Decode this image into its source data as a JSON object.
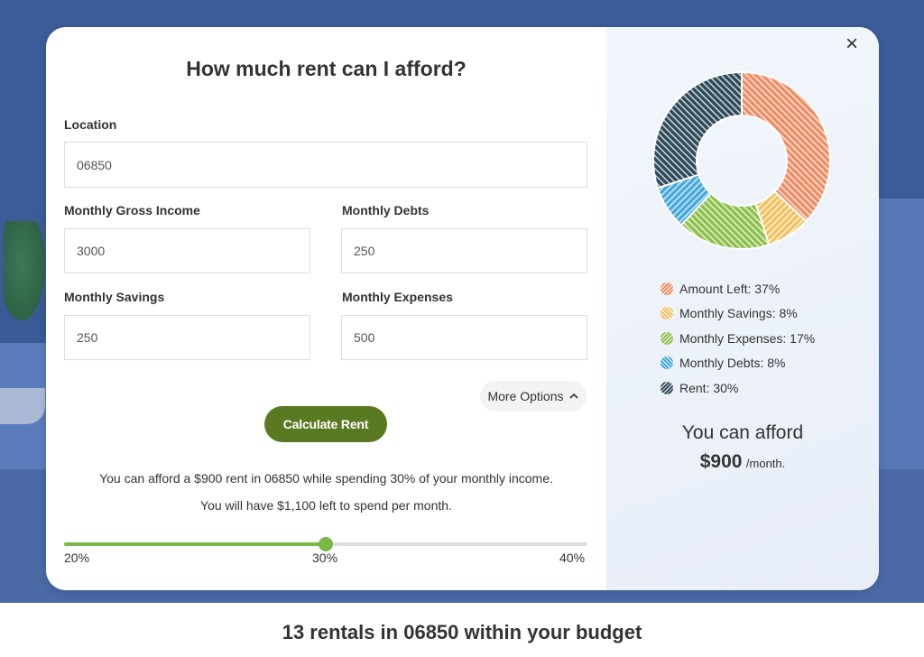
{
  "modal": {
    "title": "How much rent can I afford?",
    "close_icon": "×"
  },
  "form": {
    "location": {
      "label": "Location",
      "value": "06850"
    },
    "gross_income": {
      "label": "Monthly Gross Income",
      "value": "3000"
    },
    "debts": {
      "label": "Monthly Debts",
      "value": "250"
    },
    "savings": {
      "label": "Monthly Savings",
      "value": "250"
    },
    "expenses": {
      "label": "Monthly Expenses",
      "value": "500"
    },
    "more_options_label": "More Options",
    "calculate_label": "Calculate Rent"
  },
  "result": {
    "message_line1": "You can afford a $900 rent in 06850 while spending 30% of your monthly income.",
    "message_line2": "You will have $1,100 left to spend per month."
  },
  "slider": {
    "min_label": "20%",
    "mid_label": "30%",
    "max_label": "40%",
    "value_fraction": 0.5,
    "color": "#7ab847"
  },
  "chart_data": {
    "type": "pie",
    "categories": [
      "Amount Left",
      "Monthly Savings",
      "Monthly Expenses",
      "Monthly Debts",
      "Rent"
    ],
    "values": [
      37,
      8,
      17,
      8,
      30
    ],
    "colors": [
      "#ef8d64",
      "#f2c261",
      "#8cc04a",
      "#44a8dc",
      "#2d4a58"
    ],
    "legend": [
      {
        "label": "Amount Left: 37%"
      },
      {
        "label": "Monthly Savings: 8%"
      },
      {
        "label": "Monthly Expenses: 17%"
      },
      {
        "label": "Monthly Debts: 8%"
      },
      {
        "label": "Rent: 30%"
      }
    ]
  },
  "afford": {
    "title": "You can afford",
    "amount": "$900",
    "unit": "/month."
  },
  "footer": {
    "title": "13 rentals in 06850 within your budget"
  }
}
